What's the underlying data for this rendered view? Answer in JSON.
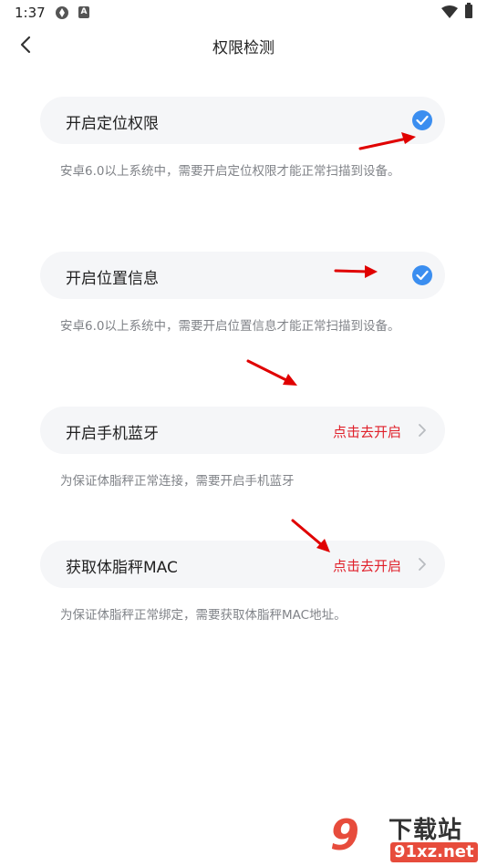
{
  "status": {
    "time": "1:37",
    "notif_badge": "A"
  },
  "header": {
    "title": "权限检测"
  },
  "items": [
    {
      "label": "开启定位权限",
      "state": "checked",
      "desc": "安卓6.0以上系统中，需要开启定位权限才能正常扫描到设备。"
    },
    {
      "label": "开启位置信息",
      "state": "checked",
      "desc": "安卓6.0以上系统中，需要开启位置信息才能正常扫描到设备。"
    },
    {
      "label": "开启手机蓝牙",
      "action": "点击去开启",
      "desc": "为保证体脂秤正常连接，需要开启手机蓝牙"
    },
    {
      "label": "获取体脂秤MAC",
      "action": "点击去开启",
      "desc": "为保证体脂秤正常绑定，需要获取体脂秤MAC地址。"
    }
  ],
  "watermark": {
    "mark": "9",
    "top": "下载站",
    "bottom": "91xz.net"
  },
  "colors": {
    "check": "#3b8ef0",
    "action": "#e0202a",
    "card_bg": "#f5f6f8",
    "arrow": "#e00000"
  }
}
